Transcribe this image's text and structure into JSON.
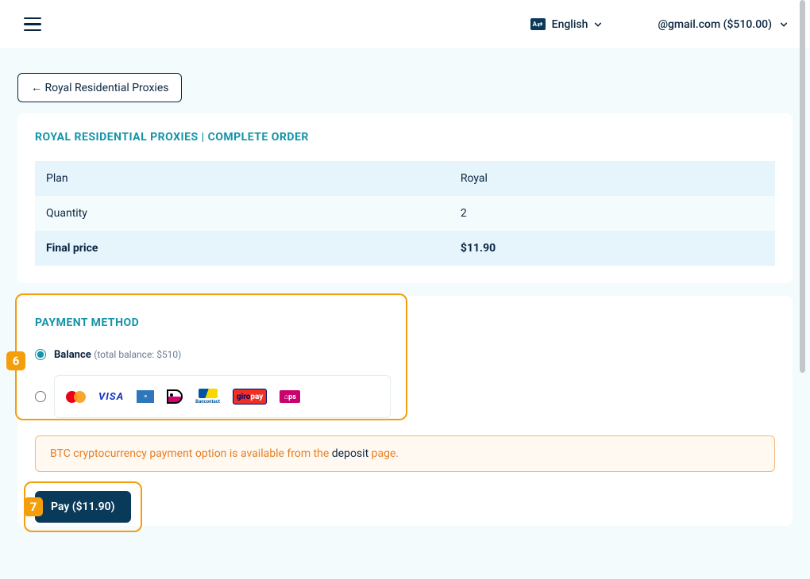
{
  "header": {
    "language_label": "English",
    "language_badge": "A⇄",
    "account_text": "@gmail.com ($510.00)"
  },
  "back_button": "← Royal Residential Proxies",
  "order": {
    "title": "ROYAL RESIDENTIAL PROXIES | COMPLETE ORDER",
    "rows": [
      {
        "label": "Plan",
        "value": "Royal"
      },
      {
        "label": "Quantity",
        "value": "2"
      },
      {
        "label": "Final price",
        "value": "$11.90"
      }
    ]
  },
  "payment": {
    "title": "PAYMENT METHOD",
    "balance_label": "Balance",
    "balance_sub": "(total balance: $510)",
    "alert_prefix": "BTC cryptocurrency payment option is available from the ",
    "alert_link": "deposit",
    "alert_suffix": " page.",
    "pay_button": "Pay ($11.90)"
  },
  "annotations": {
    "badge6": "6",
    "badge7": "7"
  },
  "icons": {
    "visa": "VISA",
    "giropay_g": "giro",
    "giropay_p": "pay",
    "eps": "⌂ps",
    "banc": "Bancontact"
  }
}
